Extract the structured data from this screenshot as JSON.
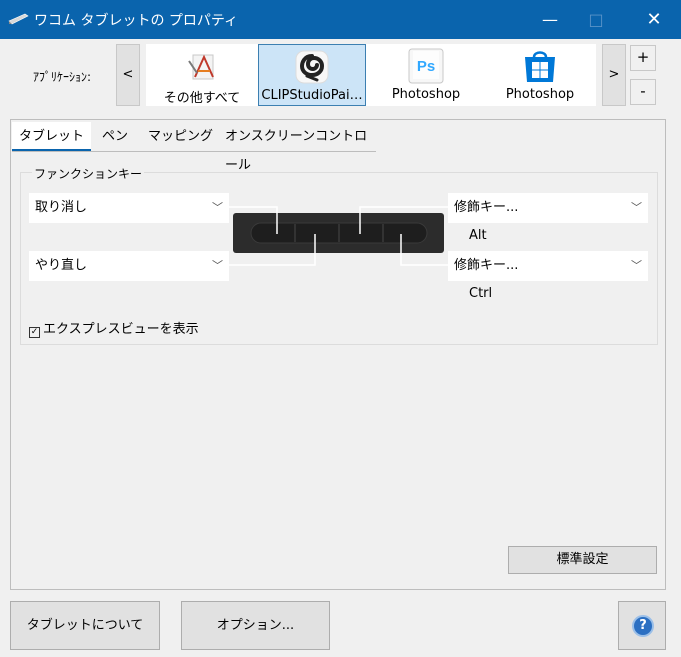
{
  "window": {
    "title": "ワコム タブレットの プロパティ",
    "minimize": "—",
    "maximize": "□",
    "close": "✕"
  },
  "application_bar": {
    "label": "ｱﾌﾟﾘｹｰｼｮﾝ:",
    "prev": "<",
    "next": ">",
    "add": "+",
    "remove": "-",
    "apps": [
      {
        "label": "その他すべて",
        "icon": "all-other-apps-icon",
        "selected": false
      },
      {
        "label": "CLIPStudioPai…",
        "icon": "clip-studio-paint-icon",
        "selected": true
      },
      {
        "label": "Photoshop",
        "icon": "photoshop-icon",
        "icon_text": "Ps",
        "selected": false
      },
      {
        "label": "Photoshop",
        "icon": "windows-store-icon",
        "selected": false
      }
    ]
  },
  "tabs": [
    {
      "label": "タブレット",
      "active": true
    },
    {
      "label": "ペン",
      "active": false
    },
    {
      "label": "マッピング",
      "active": false
    },
    {
      "label": "オンスクリーンコントロール",
      "active": false
    }
  ],
  "function_keys": {
    "title": "ファンクションキー",
    "left_top": "取り消し",
    "left_bottom": "やり直し",
    "right_top": "修飾キー...",
    "right_top_value": "Alt",
    "right_bottom": "修飾キー...",
    "right_bottom_value": "Ctrl",
    "chevron": "﹀"
  },
  "express_view": {
    "checked": true,
    "check_mark": "✓",
    "label": "エクスプレスビューを表示"
  },
  "buttons": {
    "default": "標準設定",
    "about": "タブレットについて",
    "options": "オプション...",
    "help": "?"
  },
  "colors": {
    "titlebar": "#0a64ad",
    "selection": "#cce4f7",
    "photoshop_blue": "#31a8ff",
    "store_blue": "#0078d7"
  }
}
